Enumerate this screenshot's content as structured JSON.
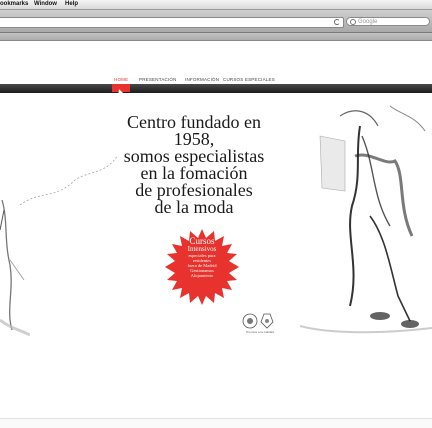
{
  "menubar": {
    "items": [
      "ookmarks",
      "Window",
      "Help"
    ]
  },
  "toolbar": {
    "url_value": "",
    "search_placeholder": "Google"
  },
  "nav": {
    "items": [
      "HOME",
      "PRESENTACIÓN",
      "INFORMACIÓN",
      "CURSOS ESPECIALES"
    ],
    "active": "HOME"
  },
  "hero": {
    "lines": [
      "Centro fundado en",
      "1958,",
      "somos especialistas",
      "en la fomación",
      "de profesionales",
      "de la moda"
    ]
  },
  "burst": {
    "title": "Cursos",
    "subtitle": "Intensivos",
    "lines": [
      "especiales para",
      "residentes",
      "fuera de Madrid",
      "Gestionamos",
      "Alojamiento"
    ]
  },
  "seal": {
    "caption": "Premios a la Calidad"
  },
  "colors": {
    "accent": "#e8322d",
    "nav_band": "#1d1d1d",
    "burst": "#e8322d"
  }
}
